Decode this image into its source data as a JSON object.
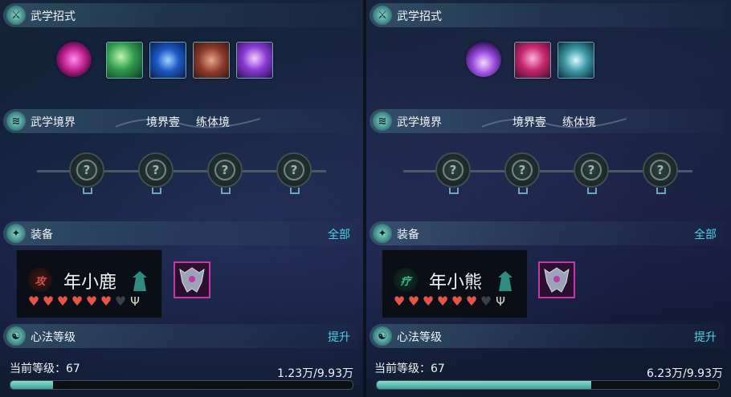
{
  "panels": [
    {
      "skills_header": "武学招式",
      "realm_header": "武学境界",
      "realm_stage": "境界壹",
      "realm_name": "练体境",
      "equipment_header": "装备",
      "equipment_link": "全部",
      "character": {
        "role": "攻",
        "role_color": "#d9504a",
        "name": "年小鹿",
        "hearts_full": 6,
        "hearts_total": 7
      },
      "mind_header": "心法等级",
      "mind_link": "提升",
      "level_text": "当前等级：67",
      "progress_text": "1.23万/9.93万",
      "progress_fraction": 0.124,
      "skill_icons": [
        "magenta-seal-icon",
        "green-wind-skill-icon",
        "blue-serpent-skill-icon",
        "red-rock-skill-icon",
        "purple-dancer-skill-icon"
      ]
    },
    {
      "skills_header": "武学招式",
      "realm_header": "武学境界",
      "realm_stage": "境界壹",
      "realm_name": "练体境",
      "equipment_header": "装备",
      "equipment_link": "全部",
      "character": {
        "role": "疗",
        "role_color": "#3fb58a",
        "name": "年小熊",
        "hearts_full": 6,
        "hearts_total": 7
      },
      "mind_header": "心法等级",
      "mind_link": "提升",
      "level_text": "当前等级：67",
      "progress_text": "6.23万/9.93万",
      "progress_fraction": 0.627,
      "skill_icons": [
        "purple-crystal-icon",
        "pink-dancer-skill-icon",
        "cyan-shell-skill-icon"
      ]
    }
  ],
  "colors": {
    "accent_link": "#4fd0e4",
    "heart": "#e85545",
    "progress_fill": "#3aa39a",
    "equip_border": "#c23aa6"
  }
}
